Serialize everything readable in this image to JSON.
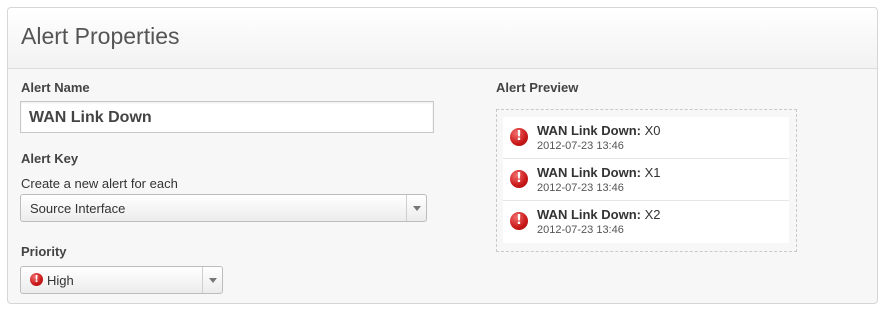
{
  "header": {
    "title": "Alert Properties"
  },
  "form": {
    "alert_name_label": "Alert Name",
    "alert_name_value": "WAN Link Down",
    "alert_key_label": "Alert Key",
    "alert_key_help": "Create a new alert for each",
    "alert_key_selected": "Source Interface",
    "priority_label": "Priority",
    "priority_selected": "High",
    "priority_icon": "exclamation-icon"
  },
  "preview": {
    "label": "Alert Preview",
    "items": [
      {
        "title": "WAN Link Down:",
        "suffix": "X0",
        "timestamp": "2012-07-23 13:46"
      },
      {
        "title": "WAN Link Down:",
        "suffix": "X1",
        "timestamp": "2012-07-23 13:46"
      },
      {
        "title": "WAN Link Down:",
        "suffix": "X2",
        "timestamp": "2012-07-23 13:46"
      }
    ]
  },
  "colors": {
    "alert_red": "#c81818",
    "panel_bg": "#f7f7f7"
  }
}
